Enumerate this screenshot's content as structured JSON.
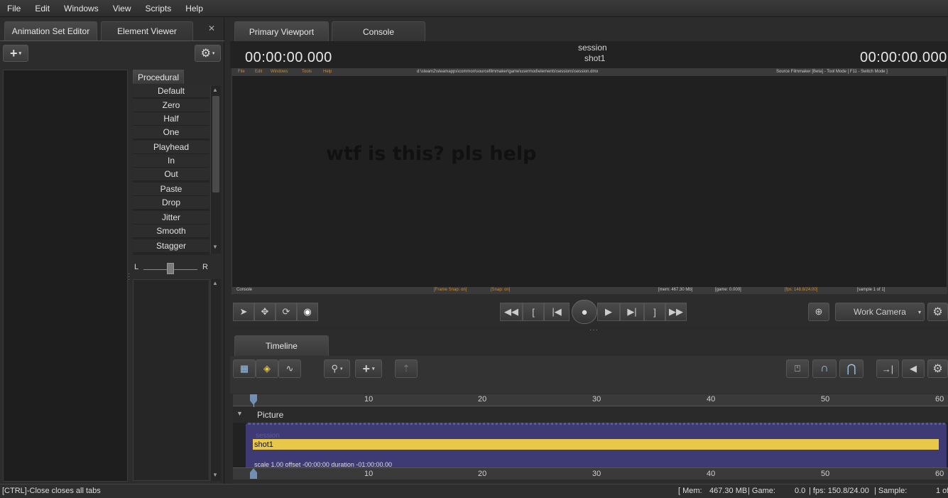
{
  "menu": [
    "File",
    "Edit",
    "Windows",
    "View",
    "Scripts",
    "Help"
  ],
  "left_tabs": {
    "animation_set_editor": "Animation Set Editor",
    "element_viewer": "Element Viewer"
  },
  "procedural": {
    "tab": "Procedural",
    "items": [
      "Default",
      "Zero",
      "Half",
      "One",
      "Playhead",
      "In",
      "Out",
      "Paste",
      "Drop",
      "Jitter",
      "Smooth",
      "Stagger"
    ],
    "slider_left": "L",
    "slider_right": "R"
  },
  "viewport": {
    "tabs": [
      "Primary Viewport",
      "Console"
    ],
    "timecode_left": "00:00:00.000",
    "timecode_right": "00:00:00.000",
    "session": "session",
    "shot": "shot1",
    "overlay_text": "wtf is this? pls help",
    "inner_menu": [
      "File",
      "Edit",
      "Windows",
      "Tools",
      "Help"
    ],
    "inner_path": "d:\\steam2\\steamapps\\common\\sourcefilmmaker\\game\\usermod\\elements\\sessions\\session.dmx",
    "inner_title": "Source Filmmaker [Beta] - Tool Mode [ F11 - Switch Mode ]",
    "inner_status": {
      "console": "Console",
      "frame_snap": "[Frame Snap: on]",
      "snap": "[Snap: on]",
      "mem": "[mem: 467.30 Mb]",
      "game": "[game: 0.000]",
      "fps": "[fps: 148.8/24.00]",
      "sample": "[sample 1 of 1]"
    },
    "camera": "Work Camera"
  },
  "timeline": {
    "tab": "Timeline",
    "ticks": [
      "10",
      "20",
      "30",
      "40",
      "50",
      "60"
    ],
    "track": "Picture",
    "session": "session",
    "shot": "shot1",
    "shot_info": "scale 1.00 offset -00:00:00 duration -01:00:00.00"
  },
  "status": {
    "left": "[CTRL]-Close closes all tabs",
    "mem_label": "[ Mem:",
    "mem_value": "467.30 MB",
    "game_label": "| Game:",
    "game_value": "0.0",
    "fps": "| fps: 150.8/24.00",
    "sample_label": "| Sample:",
    "sample_value": "1 of"
  },
  "colors": {
    "accent": "#e8c84a",
    "clip": "#3e3a74",
    "bg": "#2b2b2b"
  }
}
